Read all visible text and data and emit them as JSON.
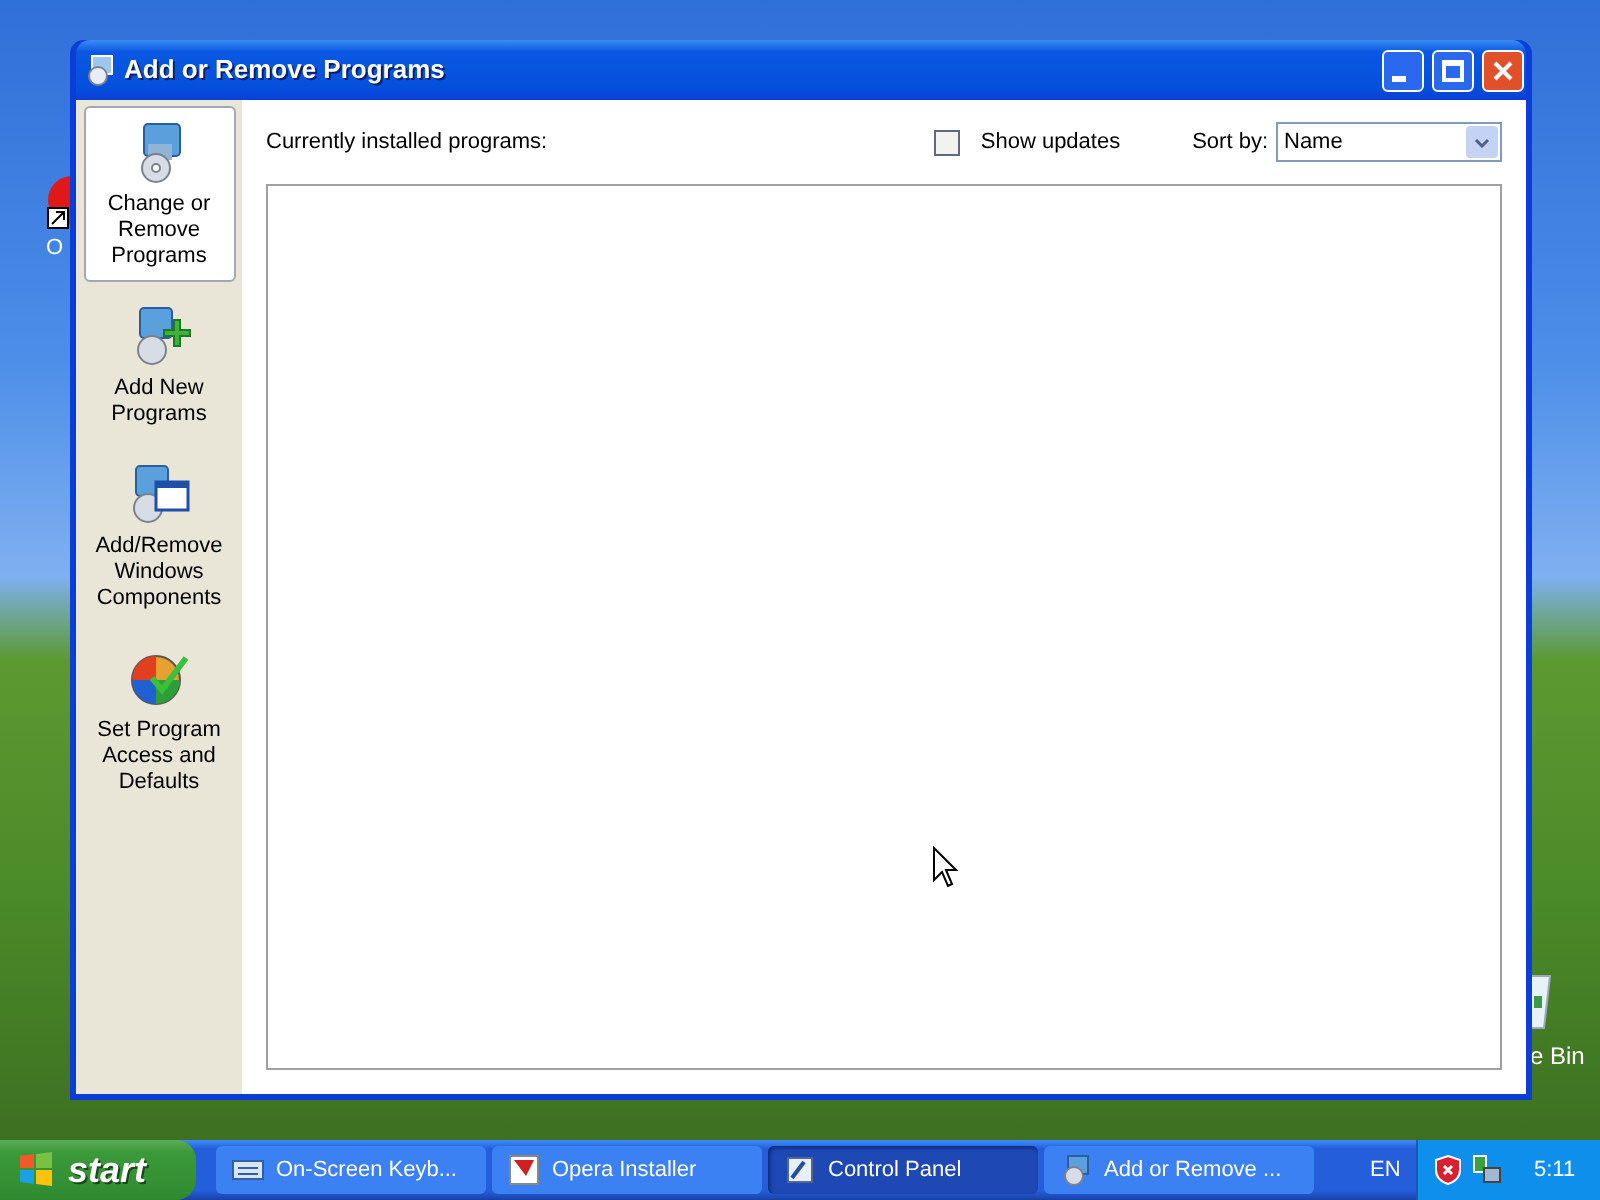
{
  "desktop": {
    "icons": [
      {
        "kind": "opera",
        "label": "O"
      },
      {
        "kind": "bin",
        "label": "e Bin"
      }
    ]
  },
  "window": {
    "title": "Add or Remove Programs",
    "sidebar": {
      "items": [
        {
          "kind": "change",
          "label": "Change or Remove Programs",
          "selected": true
        },
        {
          "kind": "add",
          "label": "Add New Programs",
          "selected": false
        },
        {
          "kind": "components",
          "label": "Add/Remove Windows Components",
          "selected": false
        },
        {
          "kind": "access",
          "label": "Set Program Access and Defaults",
          "selected": false
        }
      ]
    },
    "installed_label": "Currently installed programs:",
    "show_updates": {
      "label": "Show updates",
      "checked": false
    },
    "sort_by": {
      "label": "Sort by:",
      "value": "Name"
    }
  },
  "taskbar": {
    "start": "start",
    "buttons": [
      {
        "kind": "keyboard",
        "label": "On-Screen Keyb...",
        "selected": false
      },
      {
        "kind": "opera",
        "label": "Opera Installer",
        "selected": false
      },
      {
        "kind": "control",
        "label": "Control Panel",
        "selected": true
      },
      {
        "kind": "arp",
        "label": "Add or Remove ...",
        "selected": false
      }
    ],
    "language": "EN",
    "clock": "5:11"
  }
}
